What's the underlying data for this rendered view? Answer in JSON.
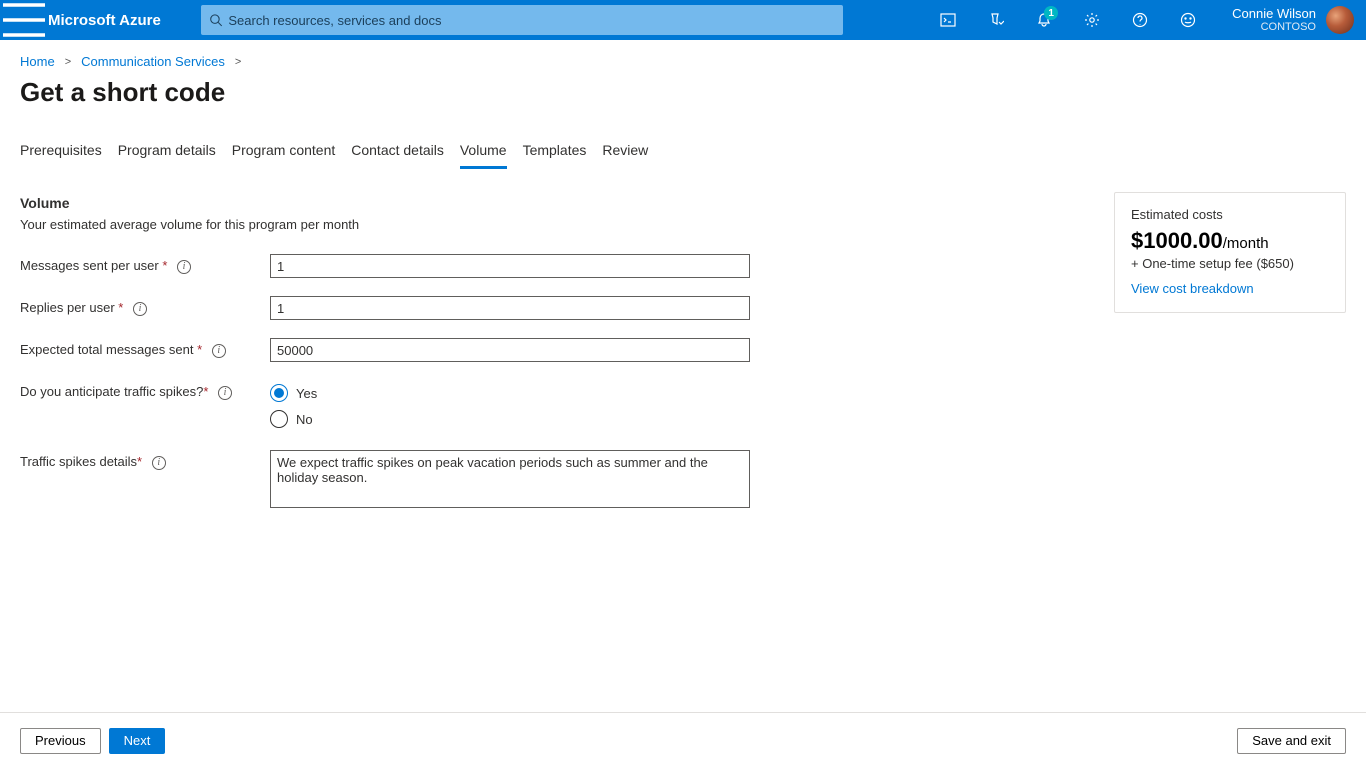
{
  "topbar": {
    "brand": "Microsoft Azure",
    "search_placeholder": "Search resources, services and docs",
    "notification_badge": "1",
    "user_name": "Connie Wilson",
    "user_org": "CONTOSO"
  },
  "breadcrumb": {
    "items": [
      "Home",
      "Communication Services"
    ]
  },
  "page": {
    "title": "Get a short code"
  },
  "tabs": [
    "Prerequisites",
    "Program details",
    "Program content",
    "Contact details",
    "Volume",
    "Templates",
    "Review"
  ],
  "active_tab": "Volume",
  "form": {
    "section_title": "Volume",
    "section_desc": "Your estimated average volume for this program per month",
    "messages_label": "Messages sent per user",
    "messages_value": "1",
    "replies_label": "Replies per user",
    "replies_value": "1",
    "expected_label": "Expected total messages sent",
    "expected_value": "50000",
    "spikes_label": "Do you anticipate traffic spikes?",
    "spikes_yes": "Yes",
    "spikes_no": "No",
    "details_label": "Traffic spikes details",
    "details_value": "We expect traffic spikes on peak vacation periods such as summer and the holiday season."
  },
  "cost": {
    "header": "Estimated costs",
    "price": "$1000.00",
    "per": "/month",
    "setup": "+ One-time setup fee ($650)",
    "link": "View cost breakdown"
  },
  "footer": {
    "previous": "Previous",
    "next": "Next",
    "save": "Save and exit"
  }
}
